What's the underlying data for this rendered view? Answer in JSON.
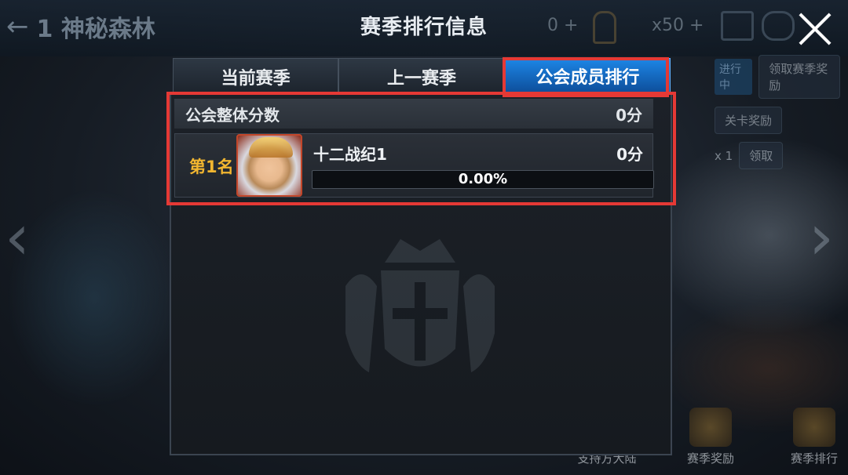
{
  "header": {
    "stage_title": "1 神秘森林",
    "dialog_title": "赛季排行信息",
    "resource_a": "0",
    "resource_b": "x50"
  },
  "tabs": [
    {
      "label": "当前赛季",
      "active": false
    },
    {
      "label": "上一赛季",
      "active": false
    },
    {
      "label": "公会成员排行",
      "active": true
    }
  ],
  "guild_total": {
    "label": "公会整体分数",
    "score": "0分"
  },
  "members": [
    {
      "rank": "第1名",
      "name": "十二战纪1",
      "score": "0分",
      "progress_text": "0.00%",
      "progress_value": 0
    }
  ],
  "background_panel": {
    "status_badge": "进行中",
    "claim_season_reward": "领取赛季奖励",
    "stage_reward": "关卡奖励",
    "reward_count": "x 1",
    "claim": "领取"
  },
  "bottom_nav": [
    {
      "label": "支持方大陆"
    },
    {
      "label": "赛季奖励"
    },
    {
      "label": "赛季排行"
    }
  ],
  "colors": {
    "accent_tab": "#1d86e6",
    "rank_gold": "#f2b630",
    "highlight_red": "#e53935"
  }
}
